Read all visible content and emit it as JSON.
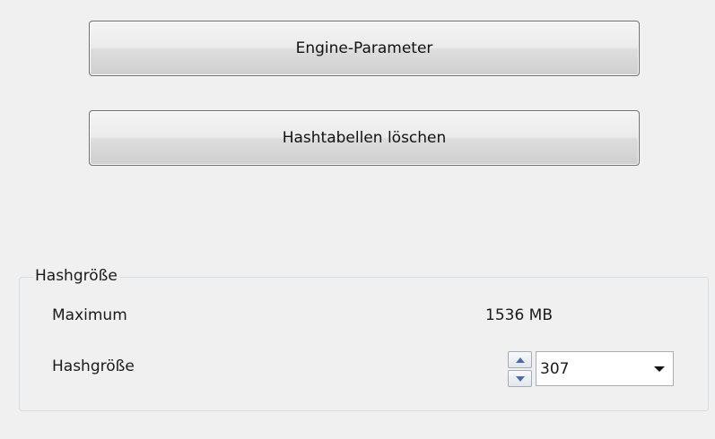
{
  "buttons": {
    "engine_parameters": "Engine-Parameter",
    "clear_hashtables": "Hashtabellen löschen"
  },
  "hash_group": {
    "legend": "Hashgröße",
    "maximum_label": "Maximum",
    "maximum_value": "1536 MB",
    "hashsize_label": "Hashgröße",
    "hashsize_value": "307"
  },
  "icons": {
    "spin_up": "triangle-up-icon",
    "spin_down": "triangle-down-icon",
    "dropdown": "chevron-down-icon"
  },
  "colors": {
    "background": "#f0f0f0",
    "spin_arrow": "#4a6ea0",
    "group_border": "#d5dfe5"
  }
}
